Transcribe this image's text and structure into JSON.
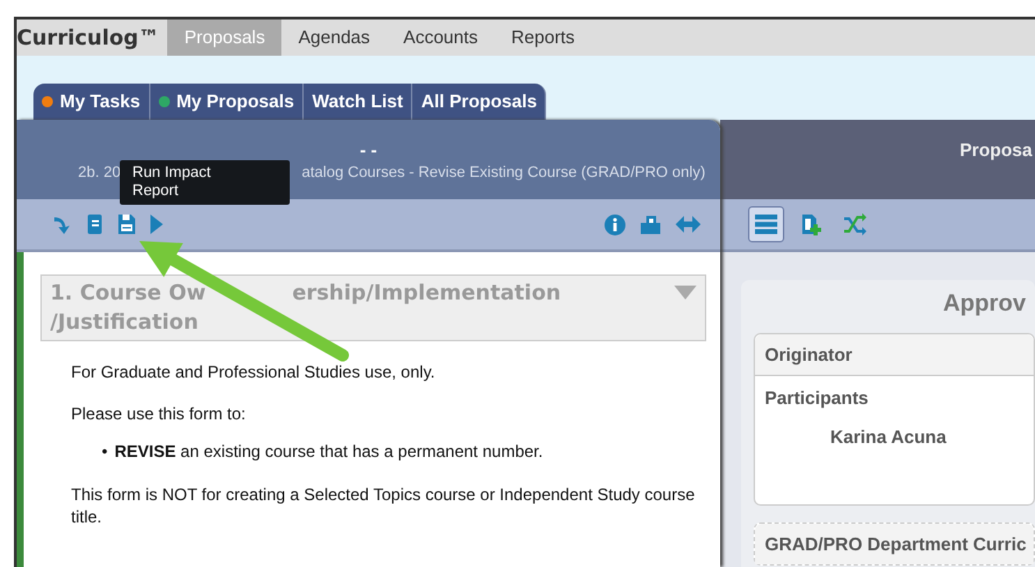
{
  "nav": {
    "logo": "Curriculog™",
    "items": [
      {
        "label": "Proposals",
        "selected": true
      },
      {
        "label": "Agendas",
        "selected": false
      },
      {
        "label": "Accounts",
        "selected": false
      },
      {
        "label": "Reports",
        "selected": false
      }
    ]
  },
  "tabs": [
    {
      "label": "My Tasks",
      "color": "#f07d10"
    },
    {
      "label": "My Proposals",
      "color": "#2ea865"
    },
    {
      "label": "Watch List"
    },
    {
      "label": "All Proposals"
    }
  ],
  "proposal": {
    "title": "- -",
    "subtitle_parts": [
      "2b. 20",
      "atalog Courses - Revise Existing Course (GRAD/PRO only)"
    ],
    "tooltip": "Run Impact Report",
    "section": {
      "heading_lines": [
        [
          "1. Course Ow",
          "ership/Implementation"
        ],
        [
          "/Justification"
        ]
      ],
      "expanded": true
    },
    "body": [
      {
        "kind": "para",
        "text": "For Graduate and Professional Studies use, only."
      },
      {
        "kind": "para",
        "text": "Please use this form to:"
      },
      {
        "kind": "bullet",
        "marker": "•",
        "text": "**REVISE** an existing course that has a permanent number."
      },
      {
        "kind": "para",
        "text": "This form is NOT for creating a Selected Topics course or Independent Study course title."
      }
    ]
  },
  "side": {
    "header": "Proposa",
    "tools": [
      {
        "kind": "list",
        "selected": true
      },
      {
        "kind": "add",
        "selected": false
      },
      {
        "kind": "shuffle",
        "selected": false
      }
    ],
    "title": "Approv",
    "steps": [
      {
        "label": "Originator",
        "participants_label": "Participants",
        "participants": [
          "Karina Acuna"
        ]
      },
      {
        "label": "GRAD/PRO Department Curric"
      }
    ]
  }
}
